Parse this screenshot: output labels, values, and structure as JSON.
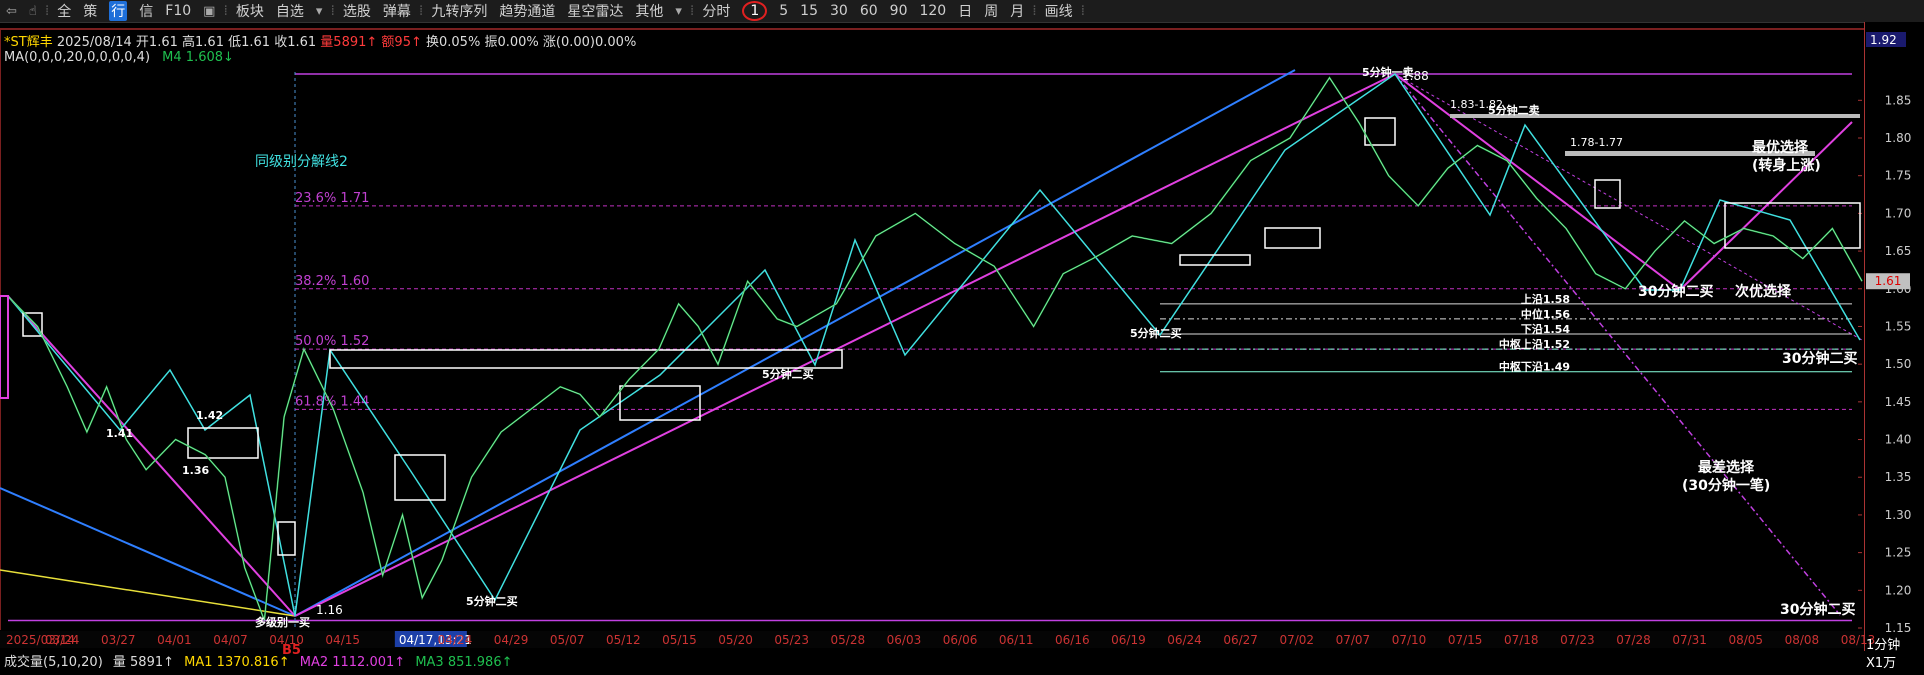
{
  "toolbar": {
    "items": [
      "全",
      "策",
      "行",
      "信",
      "F10",
      "板块",
      "自选",
      "选股",
      "弹幕",
      "九转序列",
      "趋势通道",
      "星空雷达",
      "其他",
      "分时",
      "1",
      "5",
      "15",
      "30",
      "60",
      "90",
      "120",
      "日",
      "周",
      "月",
      "画线"
    ]
  },
  "info": {
    "name": "*ST辉丰",
    "date": "2025/08/14",
    "open": "开1.61",
    "high": "高1.61",
    "low": "低1.61",
    "close": "收1.61",
    "vol": "量5891↑",
    "amount": "额95↑",
    "turnover": "换0.05%",
    "amplitude": "振0.00%",
    "change": "涨(0.00)0.00%"
  },
  "ma": {
    "label": "MA(0,0,0,20,0,0,0,0,4)",
    "m4": "M4 1.608↓"
  },
  "volume": {
    "label": "成交量(5,10,20)",
    "vol": "量 5891↑",
    "ma1": "MA1 1370.816↑",
    "ma2": "MA2 1112.001↑",
    "ma3": "MA3 851.986↑"
  },
  "period_label": "1分钟",
  "x1_label": "X1万",
  "colors": {
    "up": "#ff3b3b",
    "down": "#20d4d4",
    "price": "#1fbf4f",
    "magenta": "#e040e0",
    "blue": "#2f7fff",
    "cyan": "#40e0e0"
  },
  "chart_data": {
    "type": "line",
    "ylim": [
      1.15,
      1.93
    ],
    "y_ticks": [
      "1.92",
      "1.85",
      "1.80",
      "1.75",
      "1.70",
      "1.65",
      "1.60",
      "1.55",
      "1.50",
      "1.45",
      "1.40",
      "1.35",
      "1.30",
      "1.25",
      "1.20",
      "1.15"
    ],
    "highlight_price": "1.61",
    "x_ticks": [
      "2025/03/14",
      "03/24",
      "03/27",
      "04/01",
      "04/07",
      "04/10",
      "04/15",
      "04/17,13:21",
      "04/24",
      "04/29",
      "05/07",
      "05/12",
      "05/15",
      "05/20",
      "05/23",
      "05/28",
      "06/03",
      "06/06",
      "06/11",
      "06/16",
      "06/19",
      "06/24",
      "06/27",
      "07/02",
      "07/07",
      "07/10",
      "07/15",
      "07/18",
      "07/23",
      "07/28",
      "07/31",
      "08/05",
      "08/08",
      "08/13"
    ],
    "price_path": [
      [
        0,
        1.59
      ],
      [
        3,
        1.55
      ],
      [
        6,
        1.47
      ],
      [
        8,
        1.41
      ],
      [
        10,
        1.47
      ],
      [
        12,
        1.4
      ],
      [
        14,
        1.36
      ],
      [
        17,
        1.4
      ],
      [
        20,
        1.38
      ],
      [
        22,
        1.35
      ],
      [
        24,
        1.23
      ],
      [
        26,
        1.16
      ],
      [
        28,
        1.43
      ],
      [
        30,
        1.52
      ],
      [
        33,
        1.44
      ],
      [
        36,
        1.33
      ],
      [
        38,
        1.22
      ],
      [
        40,
        1.3
      ],
      [
        42,
        1.19
      ],
      [
        44,
        1.24
      ],
      [
        47,
        1.35
      ],
      [
        50,
        1.41
      ],
      [
        53,
        1.44
      ],
      [
        56,
        1.47
      ],
      [
        58,
        1.46
      ],
      [
        60,
        1.43
      ],
      [
        63,
        1.48
      ],
      [
        66,
        1.52
      ],
      [
        68,
        1.58
      ],
      [
        70,
        1.55
      ],
      [
        72,
        1.5
      ],
      [
        75,
        1.61
      ],
      [
        78,
        1.56
      ],
      [
        80,
        1.55
      ],
      [
        84,
        1.58
      ],
      [
        88,
        1.67
      ],
      [
        92,
        1.7
      ],
      [
        96,
        1.66
      ],
      [
        100,
        1.63
      ],
      [
        104,
        1.55
      ],
      [
        107,
        1.62
      ],
      [
        110,
        1.64
      ],
      [
        114,
        1.67
      ],
      [
        118,
        1.66
      ],
      [
        122,
        1.7
      ],
      [
        126,
        1.77
      ],
      [
        130,
        1.8
      ],
      [
        134,
        1.88
      ],
      [
        137,
        1.82
      ],
      [
        140,
        1.75
      ],
      [
        143,
        1.71
      ],
      [
        146,
        1.76
      ],
      [
        149,
        1.79
      ],
      [
        152,
        1.77
      ],
      [
        155,
        1.72
      ],
      [
        158,
        1.68
      ],
      [
        161,
        1.62
      ],
      [
        164,
        1.6
      ],
      [
        167,
        1.65
      ],
      [
        170,
        1.69
      ],
      [
        173,
        1.66
      ],
      [
        176,
        1.68
      ],
      [
        179,
        1.67
      ],
      [
        182,
        1.64
      ],
      [
        185,
        1.68
      ],
      [
        188,
        1.61
      ]
    ],
    "levels": [
      {
        "label": "23.6% 1.71",
        "value": 1.71
      },
      {
        "label": "38.2% 1.60",
        "value": 1.6
      },
      {
        "label": "50.0% 1.52",
        "value": 1.52
      },
      {
        "label": "61.8% 1.44",
        "value": 1.44
      }
    ],
    "zone_labels": [
      {
        "label": "上沿1.58",
        "value": 1.58
      },
      {
        "label": "中位1.56",
        "value": 1.56
      },
      {
        "label": "下沿1.54",
        "value": 1.54
      },
      {
        "label": "中枢上沿1.52",
        "value": 1.52
      },
      {
        "label": "中枢下沿1.49",
        "value": 1.49
      }
    ],
    "annotations": {
      "fenjie": "同级别分解线2",
      "duoji": "多级别一买",
      "b5": "B5",
      "low116": "1.16",
      "v141": "1.41",
      "v142": "1.42",
      "v136": "1.36",
      "buy2_a": "5分钟二买",
      "buy2_b": "5分钟二买",
      "buy2_c": "5分钟二买",
      "sell1": "5分钟一卖",
      "sell2": "5分钟二卖",
      "v188": "1.88",
      "range1": "1.83-1.82",
      "range2": "1.78-1.77",
      "best1": "最优选择",
      "best2": "(转身上涨)",
      "second_buy": "30分钟二买",
      "second_choice": "次优选择",
      "m30_buy2_a": "30分钟二买",
      "m30_buy2_b": "30分钟二买",
      "worst1": "最差选择",
      "worst2": "(30分钟一笔)"
    }
  }
}
